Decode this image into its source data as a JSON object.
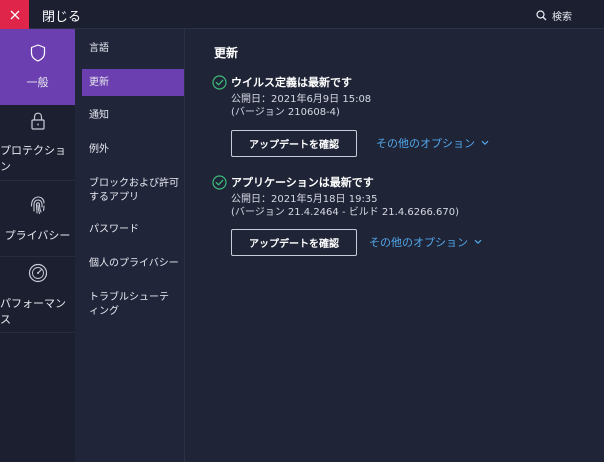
{
  "topbar": {
    "close_label": "閉じる",
    "search_label": "検索"
  },
  "leftnav": {
    "items": [
      {
        "label": "一般",
        "icon": "shield-icon",
        "active": true
      },
      {
        "label": "プロテクション",
        "icon": "lock-icon",
        "active": false
      },
      {
        "label": "プライバシー",
        "icon": "fingerprint-icon",
        "active": false
      },
      {
        "label": "パフォーマンス",
        "icon": "speedometer-icon",
        "active": false
      }
    ]
  },
  "subnav": {
    "items": [
      {
        "label": "言語"
      },
      {
        "label": "更新",
        "active": true
      },
      {
        "label": "通知"
      },
      {
        "label": "例外"
      },
      {
        "label": "ブロックおよび許可するアプリ"
      },
      {
        "label": "パスワード"
      },
      {
        "label": "個人のプライバシー"
      },
      {
        "label": "トラブルシューティング"
      }
    ]
  },
  "main": {
    "title": "更新",
    "sections": [
      {
        "title": "ウイルス定義は最新です",
        "published": "公開日：2021年6月9日 15:08",
        "version": "(バージョン 210608-4)",
        "button": "アップデートを確認",
        "options": "その他のオプション"
      },
      {
        "title": "アプリケーションは最新です",
        "published": "公開日：2021年5月18日 19:35",
        "version": "(バージョン 21.4.2464 - ビルド 21.4.6266.670)",
        "button": "アップデートを確認",
        "options": "その他のオプション"
      }
    ]
  },
  "colors": {
    "accent": "#6b3fb0",
    "close": "#e0254a",
    "link": "#52a8ec",
    "check": "#3dbb7a",
    "bg": "#1f2437"
  }
}
